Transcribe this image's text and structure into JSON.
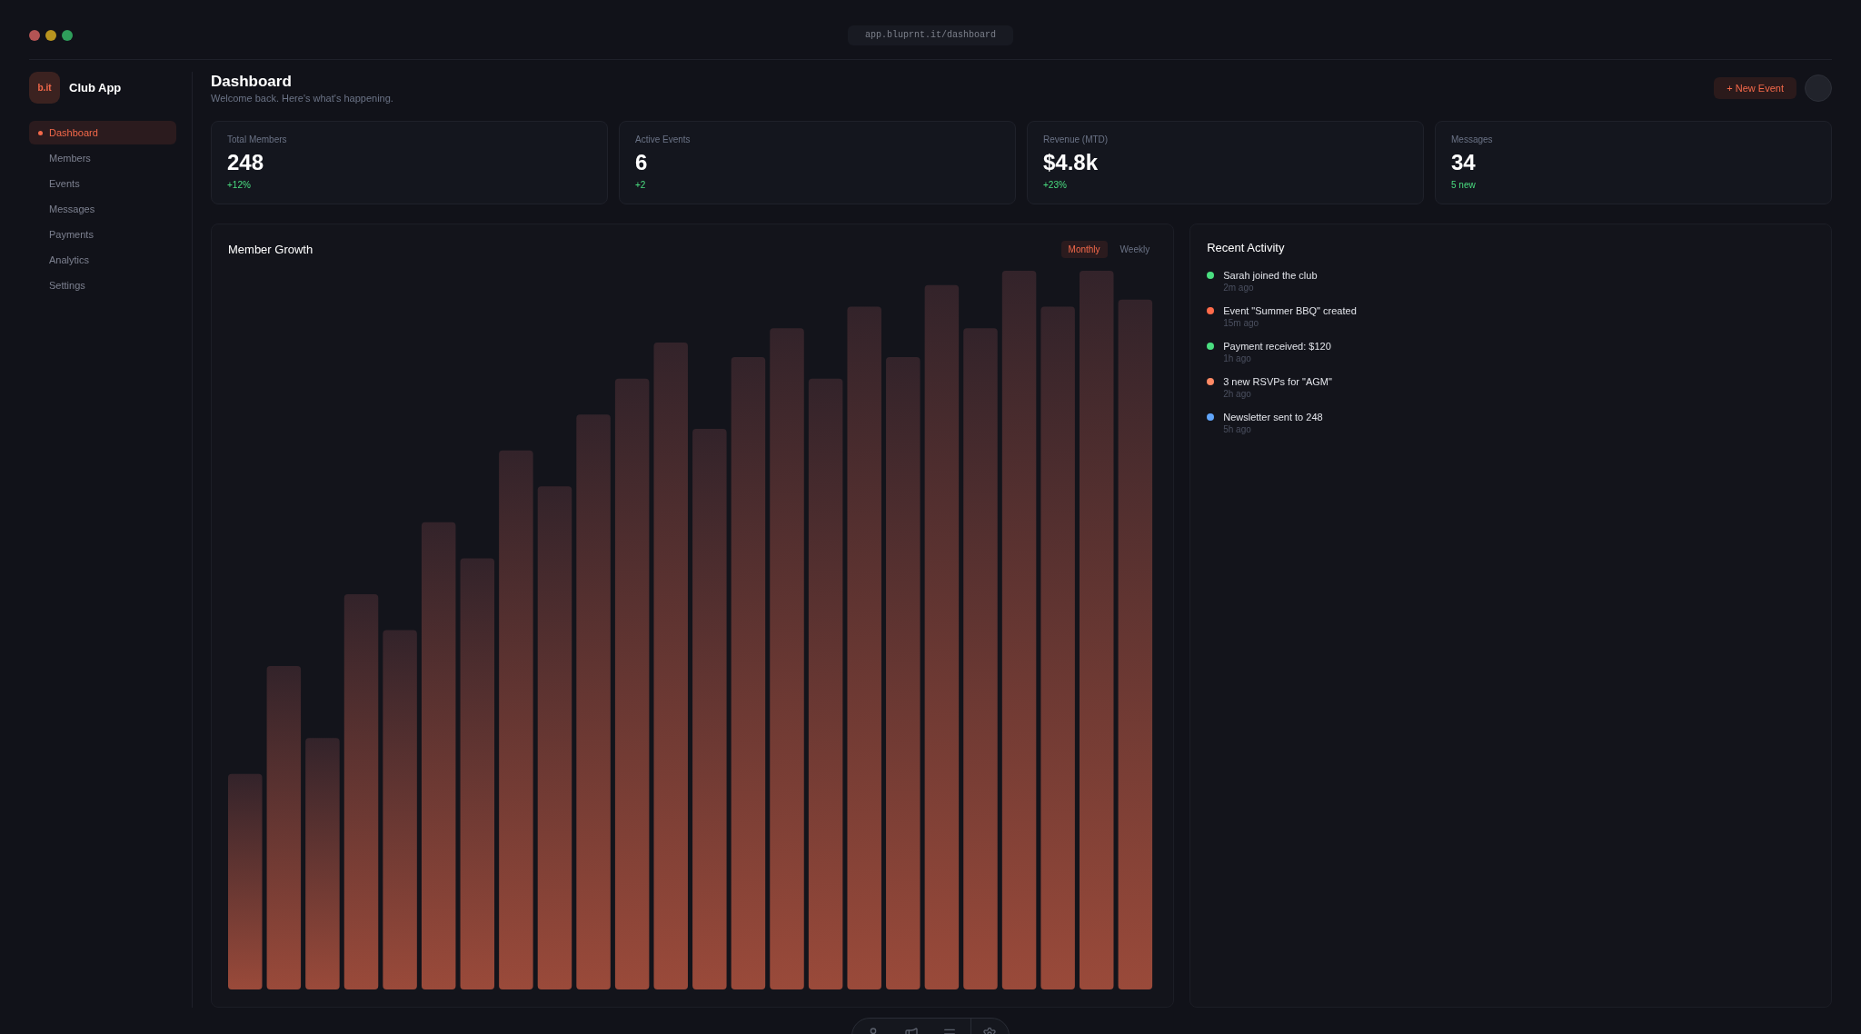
{
  "window": {
    "url": "app.bluprnt.it/dashboard"
  },
  "sidebar": {
    "logo": "b.it",
    "app_name": "Club App",
    "items": [
      {
        "label": "Dashboard",
        "selected": true
      },
      {
        "label": "Members",
        "selected": false
      },
      {
        "label": "Events",
        "selected": false
      },
      {
        "label": "Messages",
        "selected": false
      },
      {
        "label": "Payments",
        "selected": false
      },
      {
        "label": "Analytics",
        "selected": false
      },
      {
        "label": "Settings",
        "selected": false
      }
    ]
  },
  "header": {
    "title": "Dashboard",
    "subtitle": "Welcome back. Here's what's happening.",
    "new_event_button": "+ New Event"
  },
  "stats": [
    {
      "label": "Total Members",
      "value": "248",
      "change": "+12%"
    },
    {
      "label": "Active Events",
      "value": "6",
      "change": "+2"
    },
    {
      "label": "Revenue (MTD)",
      "value": "$4.8k",
      "change": "+23%"
    },
    {
      "label": "Messages",
      "value": "34",
      "change": "5 new"
    }
  ],
  "member_growth": {
    "title": "Member Growth",
    "tabs": [
      {
        "label": "Monthly",
        "selected": true
      },
      {
        "label": "Weekly",
        "selected": false
      }
    ]
  },
  "recent_activity": {
    "title": "Recent Activity",
    "items": [
      {
        "text": "Sarah joined the club",
        "time": "2m ago",
        "color": "#4ade80"
      },
      {
        "text": "Event \"Summer BBQ\" created",
        "time": "15m ago",
        "color": "#ff6b4a"
      },
      {
        "text": "Payment received: $120",
        "time": "1h ago",
        "color": "#4ade80"
      },
      {
        "text": "3 new RSVPs for \"AGM\"",
        "time": "2h ago",
        "color": "#ff8a65"
      },
      {
        "text": "Newsletter sent to 248",
        "time": "5h ago",
        "color": "#60a5fa"
      }
    ]
  }
}
